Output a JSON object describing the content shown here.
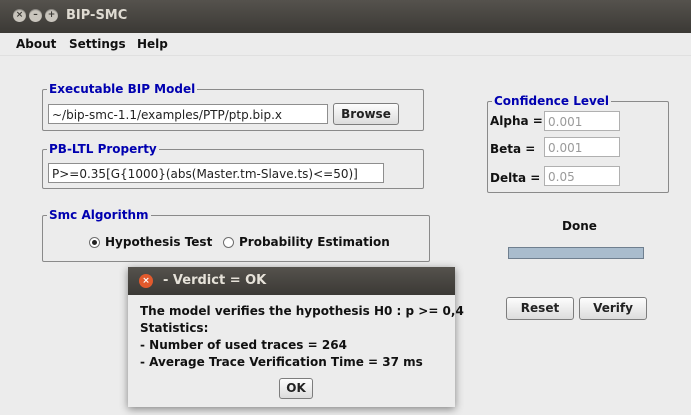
{
  "window": {
    "title": "BIP-SMC",
    "buttons": {
      "close": "×",
      "minimize": "–",
      "maximize": "+"
    }
  },
  "menu": {
    "about": "About",
    "settings": "Settings",
    "help": "Help"
  },
  "executable": {
    "title": "Executable BIP Model",
    "path": "~/bip-smc-1.1/examples/PTP/ptp.bip.x",
    "browse_label": "Browse"
  },
  "property": {
    "title": "PB-LTL Property",
    "formula": "P>=0.35[G{1000}(abs(Master.tm-Slave.ts)<=50)]"
  },
  "algorithm": {
    "title": "Smc Algorithm",
    "option1": "Hypothesis Test",
    "option2": "Probability Estimation",
    "selected": "Hypothesis Test"
  },
  "confidence": {
    "title": "Confidence Level",
    "alpha_label": "Alpha =",
    "alpha_value": "0.001",
    "beta_label": "Beta =",
    "beta_value": "0.001",
    "delta_label": "Delta =",
    "delta_value": "0.05"
  },
  "status": {
    "text": "Done",
    "progress": 1.0
  },
  "actions": {
    "reset": "Reset",
    "verify": "Verify"
  },
  "dialog": {
    "title": "- Verdict = OK",
    "close": "×",
    "line1": "The model verifies the hypothesis H0 : p >= 0,4",
    "line2": "Statistics:",
    "line3": "- Number of used traces = 264",
    "line4": "- Average Trace Verification Time = 37 ms",
    "ok": "OK"
  },
  "colors": {
    "title_bar": "#46443f",
    "group_title": "#0000b0",
    "progress_fill": "#a9bccd",
    "dialog_close": "#e25a2d"
  }
}
